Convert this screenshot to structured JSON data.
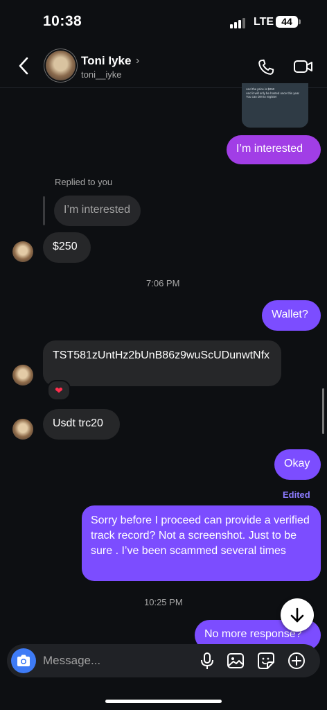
{
  "status_bar": {
    "time": "10:38",
    "network": "LTE",
    "battery": "44"
  },
  "header": {
    "name": "Toni Iyke",
    "chevron": "›",
    "username": "toni__iyke"
  },
  "shared_post": {
    "lines": [
      "And the price is $250",
      "And it will only be hosted once this year",
      "You can DM to register"
    ]
  },
  "messages": {
    "m1": "I’m interested",
    "replied_label": "Replied to you",
    "reply_quote": "I’m interested",
    "m2": "$250",
    "ts1": "7:06 PM",
    "m3": "Wallet?",
    "m4": "TST581zUntHz2bUnB86z9wuScUDunwtNfx",
    "reaction": "❤",
    "m5": "Usdt trc20",
    "m6": "Okay",
    "edited": "Edited",
    "m7": "Sorry before I proceed can provide a verified track record? Not a screenshot. Just to be sure . I’ve been scammed several times",
    "ts2": "10:25 PM",
    "m8": "No more response?"
  },
  "composer": {
    "placeholder": "Message..."
  },
  "icons": {
    "back": "chevron-left-icon",
    "call": "phone-icon",
    "video": "video-camera-icon",
    "camera": "camera-icon",
    "mic": "microphone-icon",
    "gallery": "image-icon",
    "sticker": "sticker-icon",
    "add": "plus-circle-icon",
    "scroll_down": "arrow-down-icon"
  },
  "colors": {
    "background": "#0d0f12",
    "outgoing_bubble": "#7c4dff",
    "outgoing_bubble_pink": "#a13ee6",
    "incoming_bubble": "#262729",
    "camera_button": "#3e7bf6",
    "edited_label": "#8c7bff"
  }
}
